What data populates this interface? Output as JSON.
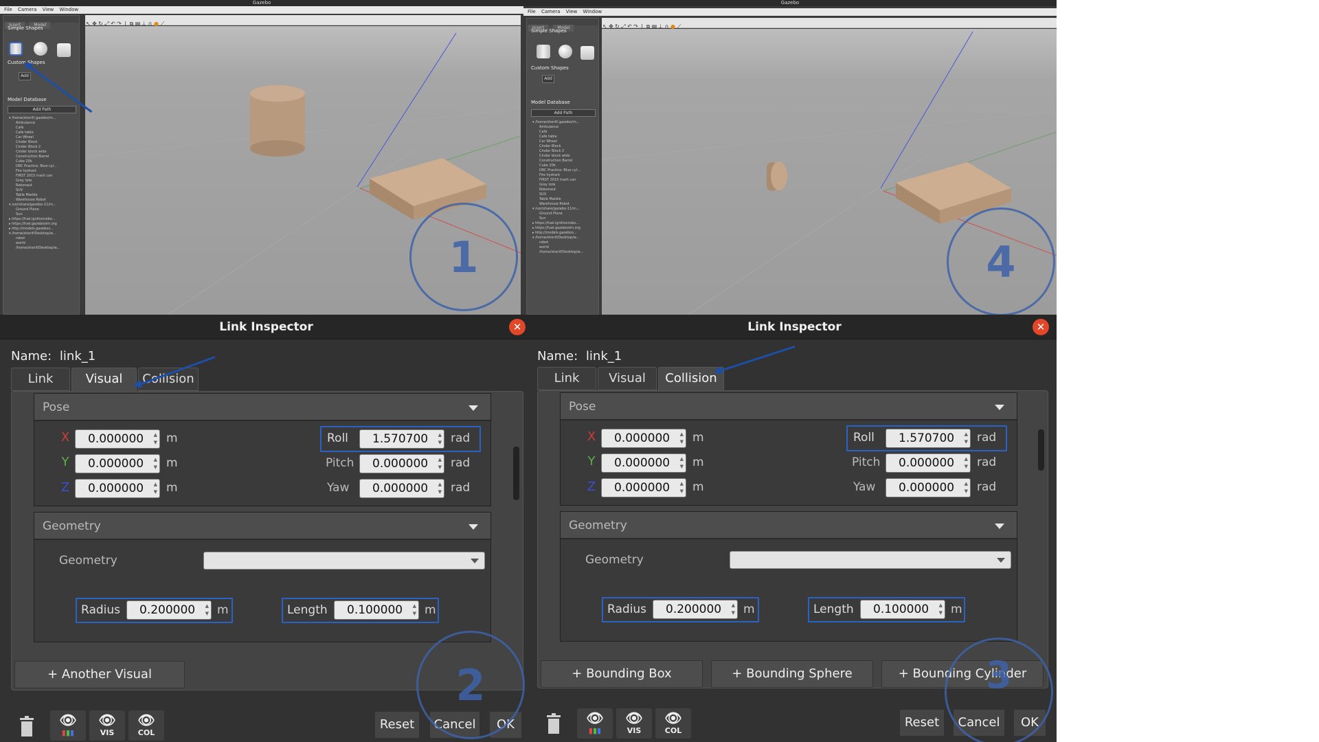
{
  "gazebo_windows": [
    {
      "title": "Gazebo",
      "menu": [
        "File",
        "Camera",
        "View",
        "Window"
      ],
      "panel_tabs": [
        "Insert",
        "Model"
      ],
      "simple_shapes_label": "Simple Shapes",
      "custom_shapes_label": "Custom Shapes",
      "add_button": "Add",
      "model_database_label": "Model Database",
      "add_path_button": "Add Path",
      "tree": [
        "▾ /home/sherif/.gazebo/m...",
        "Ambulance",
        "Cafe",
        "Cafe table",
        "Car Wheel",
        "Cinder Block",
        "Cinder Block 2",
        "Cinder block wide",
        "Construction Barrel",
        "Cube 20k",
        "DRC Practice: Blue cyl...",
        "Fire hydrant",
        "FIRST 2015 trash can",
        "Grey tote",
        "Robonaut",
        "SUV",
        "Table Marble",
        "Warehouse Robot",
        "▾ /usr/share/gazebo-11/m...",
        "Ground Plane",
        "Sun",
        "▸ https://fuel.ignitionrobo...",
        "▸ https://fuel.gazebosim.org",
        "▸ http://models.gazebos...",
        "▾ /home/sherif/Desktop/w...",
        "robot",
        "world",
        "/home/sherif/Desktop/w..."
      ],
      "step_number": "1"
    },
    {
      "title": "Gazebo",
      "menu": [
        "File",
        "Camera",
        "View",
        "Window"
      ],
      "panel_tabs": [
        "Insert",
        "Model"
      ],
      "simple_shapes_label": "Simple Shapes",
      "custom_shapes_label": "Custom Shapes",
      "add_button": "Add",
      "model_database_label": "Model Database",
      "add_path_button": "Add Path",
      "tree": [
        "▾ /home/sherif/.gazebo/m...",
        "Ambulance",
        "Cafe",
        "Cafe table",
        "Car Wheel",
        "Cinder Block",
        "Cinder Block 2",
        "Cinder block wide",
        "Construction Barrel",
        "Cube 20k",
        "DRC Practice: Blue cyl...",
        "Fire hydrant",
        "FIRST 2015 trash can",
        "Grey tote",
        "Robonaut",
        "SUV",
        "Table Marble",
        "Warehouse Robot",
        "▾ /usr/share/gazebo-11/m...",
        "Ground Plane",
        "Sun",
        "▸ https://fuel.ignitionrobo...",
        "▸ https://fuel.gazebosim.org",
        "▸ http://models.gazebos...",
        "▾ /home/sherif/Desktop/w...",
        "robot",
        "world",
        "/home/sherif/Desktop/w..."
      ],
      "step_number": "4"
    }
  ],
  "dialogs": [
    {
      "title": "Link Inspector",
      "name_label": "Name:",
      "name_value": "link_1",
      "tabs": [
        "Link",
        "Visual",
        "Collision"
      ],
      "active_tab": "Visual",
      "pose": {
        "header": "Pose",
        "x_label": "X",
        "y_label": "Y",
        "z_label": "Z",
        "x": "0.000000",
        "y": "0.000000",
        "z": "0.000000",
        "roll_label": "Roll",
        "pitch_label": "Pitch",
        "yaw_label": "Yaw",
        "roll": "1.570700",
        "pitch": "0.000000",
        "yaw": "0.000000",
        "m": "m",
        "rad": "rad"
      },
      "geometry": {
        "header": "Geometry",
        "label": "Geometry",
        "radius_label": "Radius",
        "radius": "0.200000",
        "length_label": "Length",
        "length": "0.100000",
        "unit": "m"
      },
      "add_buttons": [
        "+ Another Visual"
      ],
      "icons": {
        "vis": "VIS",
        "col": "COL"
      },
      "reset": "Reset",
      "cancel": "Cancel",
      "ok": "OK",
      "step_number": "2"
    },
    {
      "title": "Link Inspector",
      "name_label": "Name:",
      "name_value": "link_1",
      "tabs": [
        "Link",
        "Visual",
        "Collision"
      ],
      "active_tab": "Collision",
      "pose": {
        "header": "Pose",
        "x_label": "X",
        "y_label": "Y",
        "z_label": "Z",
        "x": "0.000000",
        "y": "0.000000",
        "z": "0.000000",
        "roll_label": "Roll",
        "pitch_label": "Pitch",
        "yaw_label": "Yaw",
        "roll": "1.570700",
        "pitch": "0.000000",
        "yaw": "0.000000",
        "m": "m",
        "rad": "rad"
      },
      "geometry": {
        "header": "Geometry",
        "label": "Geometry",
        "radius_label": "Radius",
        "radius": "0.200000",
        "length_label": "Length",
        "length": "0.100000",
        "unit": "m"
      },
      "add_buttons": [
        "+ Bounding Box",
        "+ Bounding Sphere",
        "+ Bounding Cylinder"
      ],
      "icons": {
        "vis": "VIS",
        "col": "COL"
      },
      "reset": "Reset",
      "cancel": "Cancel",
      "ok": "OK",
      "step_number": "3"
    }
  ],
  "colors": {
    "annotation_blue": "#2a62c4",
    "close_red": "#e2472a",
    "axis_x": "#d23b3b",
    "axis_y": "#5bb04a",
    "axis_z": "#3a4fd4"
  }
}
